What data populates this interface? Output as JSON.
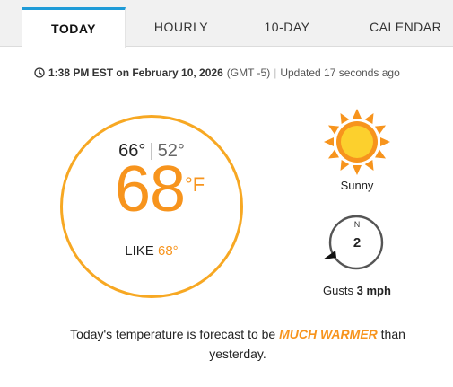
{
  "tabs": [
    {
      "label": "TODAY",
      "active": true
    },
    {
      "label": "HOURLY",
      "active": false
    },
    {
      "label": "10-DAY",
      "active": false
    },
    {
      "label": "CALENDAR",
      "active": false
    }
  ],
  "timestamp": {
    "icon": "clock-icon",
    "time": "1:38 PM EST on February 10, 2026",
    "gmt": "(GMT -5)",
    "separator": "|",
    "updated": "Updated 17 seconds ago"
  },
  "temperature": {
    "high": "66°",
    "divider": "|",
    "low": "52°",
    "current": "68",
    "unit": "°F",
    "feels_like_label": "LIKE",
    "feels_like_value": "68°"
  },
  "condition": {
    "icon": "sun-icon",
    "label": "Sunny"
  },
  "wind": {
    "icon": "wind-compass-icon",
    "direction": "N",
    "speed": "2",
    "gusts_label": "Gusts",
    "gusts_value": "3 mph"
  },
  "forecast": {
    "prefix": "Today's temperature is forecast to be",
    "emphasis": "MUCH WARMER",
    "suffix": "than yesterday."
  },
  "colors": {
    "accent_orange": "#f7941d",
    "circle_border": "#f7a823",
    "tab_active_border": "#1e9bd7",
    "sun_yellow": "#fcd02d"
  }
}
